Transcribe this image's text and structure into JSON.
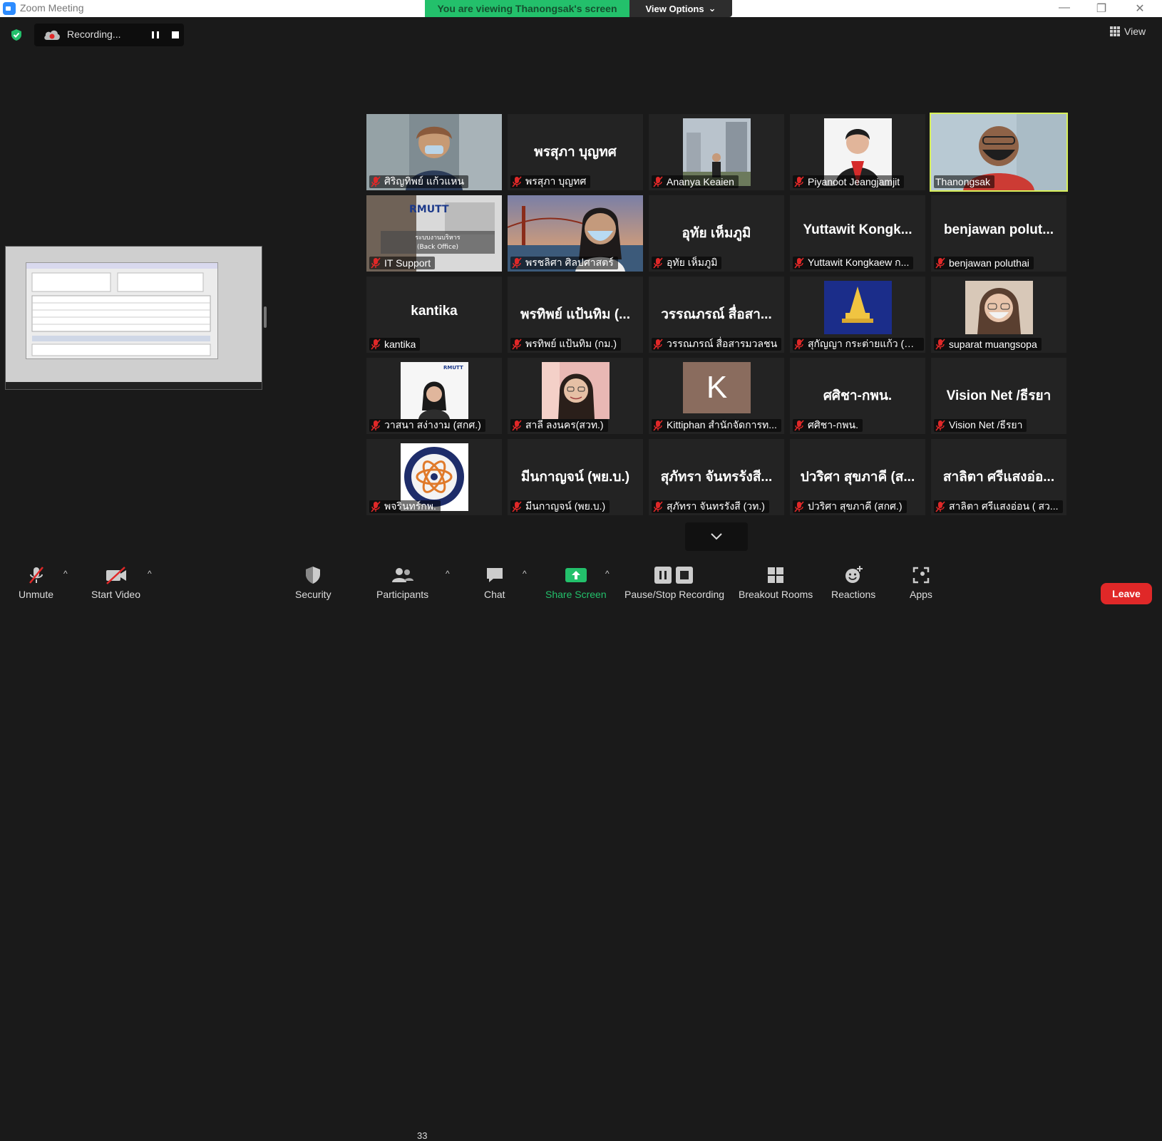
{
  "window": {
    "title": "Zoom Meeting",
    "viewing_banner": "You are viewing Thanongsak's screen",
    "view_options": "View Options",
    "controls": [
      "—",
      "❐",
      "✕"
    ]
  },
  "recording": {
    "label": "Recording..."
  },
  "view_button": {
    "label": "View"
  },
  "tiles": [
    {
      "name": "ศิริญทิพย์ แก้วแหน",
      "big": "",
      "type": "photo",
      "active": false
    },
    {
      "name": "พรสุภา บุญทศ",
      "big": "พรสุภา บุญทศ",
      "type": "text",
      "active": false
    },
    {
      "name": "Ananya Keaien",
      "big": "",
      "type": "photo",
      "active": false
    },
    {
      "name": "Piyanoot Jeangjamjit",
      "big": "",
      "type": "photo",
      "active": false
    },
    {
      "name": "Thanongsak",
      "big": "",
      "type": "photo",
      "active": true
    },
    {
      "name": "IT Support",
      "big": "",
      "type": "photo",
      "active": false
    },
    {
      "name": "พรชลิศา ศิลปศาสตร์",
      "big": "",
      "type": "photo",
      "active": false
    },
    {
      "name": "อุทัย เห็มภูมิ",
      "big": "อุทัย เห็มภูมิ",
      "type": "text",
      "active": false
    },
    {
      "name": "Yuttawit Kongkaew ก...",
      "big": "Yuttawit Kongk...",
      "type": "text",
      "active": false
    },
    {
      "name": "benjawan poluthai",
      "big": "benjawan polut...",
      "type": "text",
      "active": false
    },
    {
      "name": "kantika",
      "big": "kantika",
      "type": "text",
      "active": false
    },
    {
      "name": "พรทิพย์ แป้นทิม (กม.)",
      "big": "พรทิพย์ แป้นทิม (...",
      "type": "text",
      "active": false
    },
    {
      "name": "วรรณภรณ์ สื่อสารมวลชน",
      "big": "วรรณภรณ์ สื่อสา...",
      "type": "text",
      "active": false
    },
    {
      "name": "สุกัญญา กระต่ายแก้ว (สวท.)",
      "big": "",
      "type": "photo",
      "active": false
    },
    {
      "name": "suparat muangsopa",
      "big": "",
      "type": "photo",
      "active": false
    },
    {
      "name": "วาสนา สง่างาม (สกศ.)",
      "big": "",
      "type": "photo",
      "active": false
    },
    {
      "name": "สาลี ลงนคร(สวท.)",
      "big": "",
      "type": "photo",
      "active": false
    },
    {
      "name": "Kittiphan สำนักจัดการท...",
      "big": "",
      "type": "letter",
      "letter": "K",
      "active": false
    },
    {
      "name": "ศศิชา-กพน.",
      "big": "ศศิชา-กพน.",
      "type": "text",
      "active": false
    },
    {
      "name": "Vision Net /ธีรยา",
      "big": "Vision Net /ธีรยา",
      "type": "text",
      "active": false
    },
    {
      "name": "พจรินทร์กพ.",
      "big": "",
      "type": "photo",
      "active": false
    },
    {
      "name": "มีนกาญจน์ (พย.บ.)",
      "big": "มีนกาญจน์ (พย.บ.)",
      "type": "text",
      "active": false
    },
    {
      "name": "สุภัทรา จันทรรังสี (วท.)",
      "big": "สุภัทรา จันทรรังสี...",
      "type": "text",
      "active": false
    },
    {
      "name": "ปวริศา สุขภาคี (สกศ.)",
      "big": "ปวริศา สุขภาคี (ส...",
      "type": "text",
      "active": false
    },
    {
      "name": "สาลิตา ศรีแสงอ่อน ( สว...",
      "big": "สาลิตา ศรีแสงอ่อ...",
      "type": "text",
      "active": false
    }
  ],
  "toolbar": {
    "unmute": "Unmute",
    "start_video": "Start Video",
    "security": "Security",
    "participants": "Participants",
    "participants_count": "33",
    "chat": "Chat",
    "share_screen": "Share Screen",
    "pause_stop_recording": "Pause/Stop Recording",
    "breakout_rooms": "Breakout Rooms",
    "reactions": "Reactions",
    "apps": "Apps",
    "leave": "Leave"
  },
  "colors": {
    "banner_green": "#23c06b",
    "active_border": "#d8f05a",
    "muted_red": "#e02828",
    "background": "#1a1a1a"
  }
}
